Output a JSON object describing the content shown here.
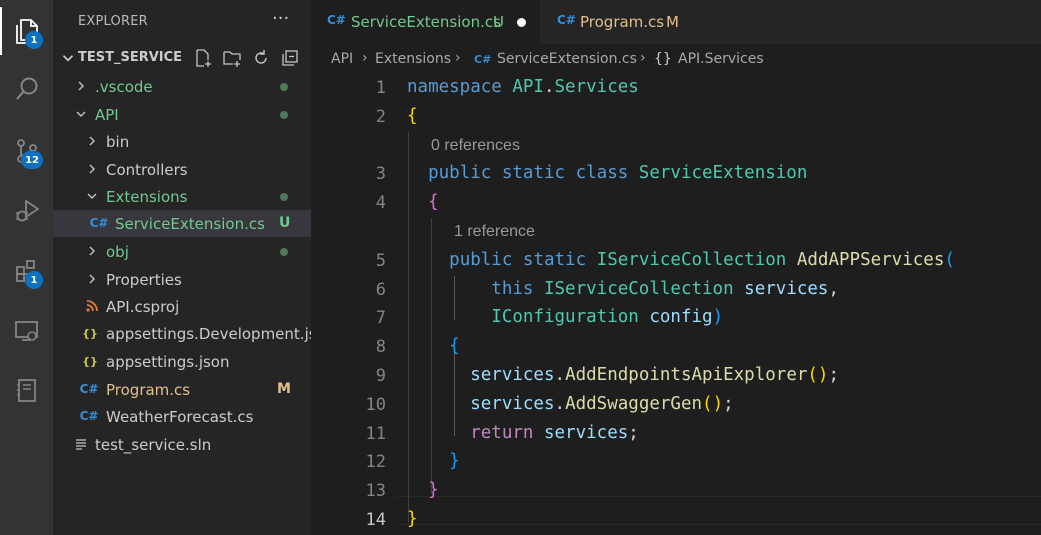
{
  "activity_bar": {
    "items": [
      {
        "icon": "explorer-icon",
        "badge": "1"
      },
      {
        "icon": "search-icon",
        "badge": ""
      },
      {
        "icon": "source-control-icon",
        "badge": "12"
      },
      {
        "icon": "run-debug-icon",
        "badge": ""
      },
      {
        "icon": "extensions-icon",
        "badge": "1"
      },
      {
        "icon": "remote-explorer-icon",
        "badge": ""
      },
      {
        "icon": "notebook-icon",
        "badge": ""
      }
    ]
  },
  "sidebar": {
    "title": "EXPLORER",
    "more": "···",
    "section": "TEST_SERVICE",
    "tree": [
      {
        "label": ".vscode",
        "kind": "folder",
        "open": false,
        "color": "green",
        "dot": true
      },
      {
        "label": "API",
        "kind": "folder",
        "open": true,
        "color": "green",
        "dot": true
      },
      {
        "label": "bin",
        "kind": "folder",
        "open": false,
        "color": "",
        "dot": false
      },
      {
        "label": "Controllers",
        "kind": "folder",
        "open": false,
        "color": "",
        "dot": false
      },
      {
        "label": "Extensions",
        "kind": "folder",
        "open": true,
        "color": "green",
        "dot": true
      },
      {
        "label": "ServiceExtension.cs",
        "kind": "cs",
        "status": "U",
        "color": "green",
        "selected": true
      },
      {
        "label": "obj",
        "kind": "folder",
        "open": false,
        "color": "green",
        "dot": true
      },
      {
        "label": "Properties",
        "kind": "folder",
        "open": false,
        "color": "",
        "dot": false
      },
      {
        "label": "API.csproj",
        "kind": "rss",
        "color": ""
      },
      {
        "label": "appsettings.Development.json",
        "kind": "json",
        "color": ""
      },
      {
        "label": "appsettings.json",
        "kind": "json",
        "color": ""
      },
      {
        "label": "Program.cs",
        "kind": "cs",
        "status": "M",
        "color": "modified"
      },
      {
        "label": "WeatherForecast.cs",
        "kind": "cs",
        "color": ""
      },
      {
        "label": "test_service.sln",
        "kind": "sln",
        "color": ""
      }
    ]
  },
  "tabs": [
    {
      "label": "ServiceExtension.cs",
      "status": "U",
      "icon": "C#",
      "active": true,
      "dirty": true
    },
    {
      "label": "Program.cs",
      "status": "M",
      "icon": "C#",
      "active": false,
      "dirty": false
    }
  ],
  "breadcrumb": [
    "API",
    "Extensions",
    "ServiceExtension.cs",
    "API.Services"
  ],
  "breadcrumb_icons": {
    "file": "C#",
    "namespace": "{}"
  },
  "editor": {
    "current_line": "14",
    "lines": [
      {
        "n": "1",
        "tokens": [
          [
            "kw",
            "namespace "
          ],
          [
            "ty",
            "API"
          ],
          [
            "pl",
            "."
          ],
          [
            "ty",
            "Services"
          ]
        ]
      },
      {
        "n": "2",
        "tokens": [
          [
            "b1",
            "{"
          ]
        ]
      },
      {
        "n": "",
        "lens": "0 references"
      },
      {
        "n": "3",
        "tokens": [
          [
            "pl",
            "  "
          ],
          [
            "kw",
            "public static class "
          ],
          [
            "ty",
            "ServiceExtension"
          ]
        ]
      },
      {
        "n": "4",
        "tokens": [
          [
            "pl",
            "  "
          ],
          [
            "b2",
            "{"
          ]
        ]
      },
      {
        "n": "",
        "lens": "1 reference"
      },
      {
        "n": "5",
        "tokens": [
          [
            "pl",
            "    "
          ],
          [
            "kw",
            "public static "
          ],
          [
            "ty",
            "IServiceCollection "
          ],
          [
            "fn",
            "AddAPPServices"
          ],
          [
            "b3",
            "("
          ]
        ]
      },
      {
        "n": "6",
        "tokens": [
          [
            "pl",
            "        "
          ],
          [
            "kw",
            "this "
          ],
          [
            "ty",
            "IServiceCollection "
          ],
          [
            "var",
            "services"
          ],
          [
            "pl",
            ","
          ]
        ]
      },
      {
        "n": "7",
        "tokens": [
          [
            "pl",
            "        "
          ],
          [
            "ty",
            "IConfiguration "
          ],
          [
            "var",
            "config"
          ],
          [
            "b3",
            ")"
          ]
        ]
      },
      {
        "n": "8",
        "tokens": [
          [
            "pl",
            "    "
          ],
          [
            "b3",
            "{"
          ]
        ]
      },
      {
        "n": "9",
        "tokens": [
          [
            "pl",
            "      "
          ],
          [
            "var",
            "services"
          ],
          [
            "pl",
            "."
          ],
          [
            "fn",
            "AddEndpointsApiExplorer"
          ],
          [
            "b1",
            "()"
          ],
          [
            "pl",
            ";"
          ]
        ]
      },
      {
        "n": "10",
        "tokens": [
          [
            "pl",
            "      "
          ],
          [
            "var",
            "services"
          ],
          [
            "pl",
            "."
          ],
          [
            "fn",
            "AddSwaggerGen"
          ],
          [
            "b1",
            "()"
          ],
          [
            "pl",
            ";"
          ]
        ]
      },
      {
        "n": "11",
        "tokens": [
          [
            "pl",
            "      "
          ],
          [
            "ctl",
            "return "
          ],
          [
            "var",
            "services"
          ],
          [
            "pl",
            ";"
          ]
        ]
      },
      {
        "n": "12",
        "tokens": [
          [
            "pl",
            "    "
          ],
          [
            "b3",
            "}"
          ]
        ]
      },
      {
        "n": "13",
        "tokens": [
          [
            "pl",
            "  "
          ],
          [
            "b2",
            "}"
          ]
        ]
      },
      {
        "n": "14",
        "tokens": [
          [
            "b1",
            "}"
          ]
        ]
      }
    ]
  },
  "colors": {
    "activity_bar": "#333333",
    "sidebar": "#252526",
    "editor": "#1e1e1e",
    "badge": "#0e70c0",
    "untracked": "#73c991",
    "modified": "#e2c08d"
  }
}
